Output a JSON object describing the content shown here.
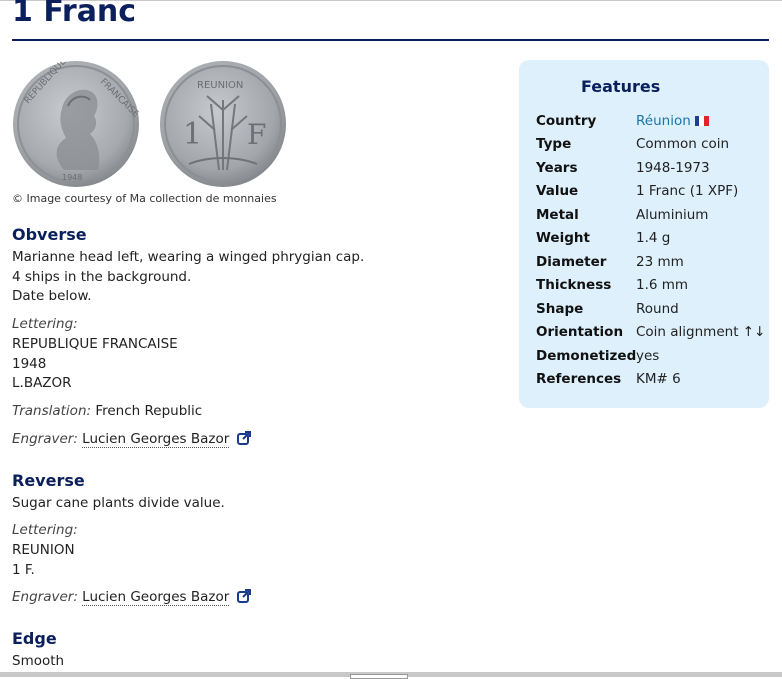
{
  "page": {
    "title": "1 Franc"
  },
  "images": {
    "credit": "© Image courtesy of Ma collection de monnaies"
  },
  "obverse": {
    "heading": "Obverse",
    "description": [
      "Marianne head left, wearing a winged phrygian cap.",
      "4 ships in the background.",
      "Date below."
    ],
    "lettering_label": "Lettering:",
    "lettering": [
      "REPUBLIQUE FRANCAISE",
      "1948",
      "L.BAZOR"
    ],
    "translation_label": "Translation:",
    "translation": "French Republic",
    "engraver_label": "Engraver:",
    "engraver": "Lucien Georges Bazor"
  },
  "reverse": {
    "heading": "Reverse",
    "description": "Sugar cane plants divide value.",
    "lettering_label": "Lettering:",
    "lettering": [
      "REUNION",
      "1 F."
    ],
    "engraver_label": "Engraver:",
    "engraver": "Lucien Georges Bazor"
  },
  "edge": {
    "heading": "Edge",
    "description": "Smooth"
  },
  "features": {
    "heading": "Features",
    "rows": [
      {
        "key": "Country",
        "value": "Réunion"
      },
      {
        "key": "Type",
        "value": "Common coin"
      },
      {
        "key": "Years",
        "value": "1948-1973"
      },
      {
        "key": "Value",
        "value": "1 Franc (1 XPF)"
      },
      {
        "key": "Metal",
        "value": "Aluminium"
      },
      {
        "key": "Weight",
        "value": "1.4 g"
      },
      {
        "key": "Diameter",
        "value": "23 mm"
      },
      {
        "key": "Thickness",
        "value": "1.6 mm"
      },
      {
        "key": "Shape",
        "value": "Round"
      },
      {
        "key": "Orientation",
        "value": "Coin alignment ↑↓"
      },
      {
        "key": "Demonetized",
        "value": "yes"
      },
      {
        "key": "References",
        "value": "KM# 6"
      }
    ],
    "flag_colors": [
      "#1f3f99",
      "#ffffff",
      "#e0242c"
    ]
  },
  "icons": {
    "external_link": "external-link-icon"
  },
  "colors": {
    "heading": "#0b1f5c",
    "panel_bg": "#ddf0fb",
    "link": "#1a73a8"
  }
}
